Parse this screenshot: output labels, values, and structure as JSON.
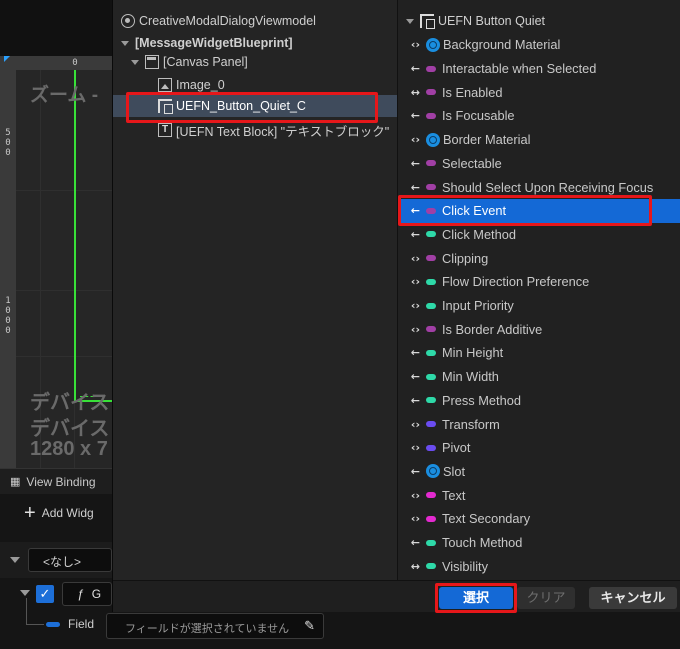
{
  "background": {
    "ruler_top": [
      "0"
    ],
    "ruler_left_a": [
      "5",
      "0",
      "0"
    ],
    "ruler_left_b": [
      "1",
      "0",
      "0",
      "0"
    ],
    "canvas_overlay": [
      "ズーム -",
      "デバイス",
      "デバイス",
      "1280 x 7"
    ],
    "view_binding_label": "View Binding",
    "add_widget_label": "Add Widg",
    "nashi_label": "<なし>",
    "binding_fn_label": "G",
    "field_label": "Field",
    "field_placeholder": "フィールドが選択されていません"
  },
  "tree": {
    "viewmodel": "CreativeModalDialogViewmodel",
    "blueprint": "[MessageWidgetBlueprint]",
    "canvas_panel": "[Canvas Panel]",
    "image": "Image_0",
    "button": "UEFN_Button_Quiet_C",
    "text_block": "[UEFN Text Block] \"テキストブロック\""
  },
  "properties": {
    "header": "UEFN Button Quiet",
    "items": [
      {
        "arrow": "‹›",
        "pin": "globe",
        "label": "Background Material"
      },
      {
        "arrow": "←",
        "pin": "#a13fa5",
        "label": "Interactable when Selected"
      },
      {
        "arrow": "↔",
        "pin": "#a13fa5",
        "label": "Is Enabled"
      },
      {
        "arrow": "←",
        "pin": "#a13fa5",
        "label": "Is Focusable"
      },
      {
        "arrow": "‹›",
        "pin": "globe",
        "label": "Border Material"
      },
      {
        "arrow": "←",
        "pin": "#a13fa5",
        "label": "Selectable"
      },
      {
        "arrow": "←",
        "pin": "#a13fa5",
        "label": "Should Select Upon Receiving Focus"
      },
      {
        "arrow": "←",
        "pin": "#a13fa5",
        "label": "Click Event"
      },
      {
        "arrow": "←",
        "pin": "#2ed9a8",
        "label": "Click Method"
      },
      {
        "arrow": "‹›",
        "pin": "#a13fa5",
        "label": "Clipping"
      },
      {
        "arrow": "‹›",
        "pin": "#2ed9a8",
        "label": "Flow Direction Preference"
      },
      {
        "arrow": "‹›",
        "pin": "#2ed9a8",
        "label": "Input Priority"
      },
      {
        "arrow": "‹›",
        "pin": "#a13fa5",
        "label": "Is Border Additive"
      },
      {
        "arrow": "←",
        "pin": "#2ed9a8",
        "label": "Min Height"
      },
      {
        "arrow": "←",
        "pin": "#2ed9a8",
        "label": "Min Width"
      },
      {
        "arrow": "←",
        "pin": "#2ed9a8",
        "label": "Press Method"
      },
      {
        "arrow": "‹›",
        "pin": "#6a4cf0",
        "label": "Transform"
      },
      {
        "arrow": "‹›",
        "pin": "#6a4cf0",
        "label": "Pivot"
      },
      {
        "arrow": "←",
        "pin": "globe",
        "label": "Slot"
      },
      {
        "arrow": "‹›",
        "pin": "#e42ad0",
        "label": "Text"
      },
      {
        "arrow": "‹›",
        "pin": "#e42ad0",
        "label": "Text Secondary"
      },
      {
        "arrow": "←",
        "pin": "#2ed9a8",
        "label": "Touch Method"
      },
      {
        "arrow": "↔",
        "pin": "#2ed9a8",
        "label": "Visibility"
      }
    ],
    "selected_index": 7
  },
  "footer": {
    "select_label": "選択",
    "clear_label": "クリア",
    "cancel_label": "キャンセル"
  },
  "colors": {
    "accent": "#1469d6",
    "highlight_red": "#e6171a",
    "tree_selected": "#3f4b5c"
  }
}
